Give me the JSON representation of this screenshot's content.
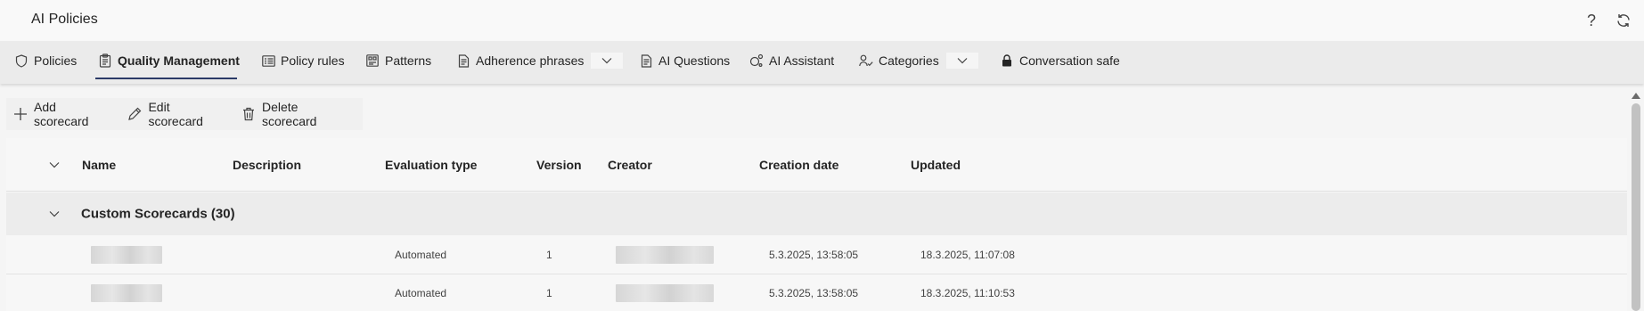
{
  "header": {
    "title": "AI Policies",
    "icons": [
      "help-icon",
      "refresh-icon"
    ],
    "help_glyph": "?"
  },
  "tabs": [
    {
      "label": "Policies",
      "icon": "shield-icon"
    },
    {
      "label": "Quality Management",
      "icon": "clipboard-icon",
      "active": true
    },
    {
      "label": "Policy rules",
      "icon": "rules-icon"
    },
    {
      "label": "Patterns",
      "icon": "patterns-icon"
    },
    {
      "label": "Adherence phrases",
      "icon": "document-icon",
      "dropdown": true
    },
    {
      "label": "AI Questions",
      "icon": "document-icon"
    },
    {
      "label": "AI Assistant",
      "icon": "ai-sparkle-icon"
    },
    {
      "label": "Categories",
      "icon": "people-icon",
      "dropdown": true
    },
    {
      "label": "Conversation safe",
      "icon": "lock-icon"
    }
  ],
  "toolbar": {
    "add_label": "Add scorecard",
    "edit_label": "Edit scorecard",
    "delete_label": "Delete scorecard"
  },
  "table": {
    "columns": [
      "Name",
      "Description",
      "Evaluation type",
      "Version",
      "Creator",
      "Creation date",
      "Updated"
    ],
    "group": {
      "title": "Custom Scorecards (30)"
    },
    "rows": [
      {
        "name": "",
        "description": "",
        "evaluation_type": "Automated",
        "version": "1",
        "creator": "",
        "creation_date": "5.3.2025, 13:58:05",
        "updated": "18.3.2025, 11:07:08"
      },
      {
        "name": "",
        "description": "",
        "evaluation_type": "Automated",
        "version": "1",
        "creator": "",
        "creation_date": "5.3.2025, 13:58:05",
        "updated": "18.3.2025, 11:10:53"
      }
    ]
  },
  "colors": {
    "accent_underline": "#2b3a67",
    "tabbar_bg": "#ebebeb",
    "group_bg": "#ececec"
  }
}
